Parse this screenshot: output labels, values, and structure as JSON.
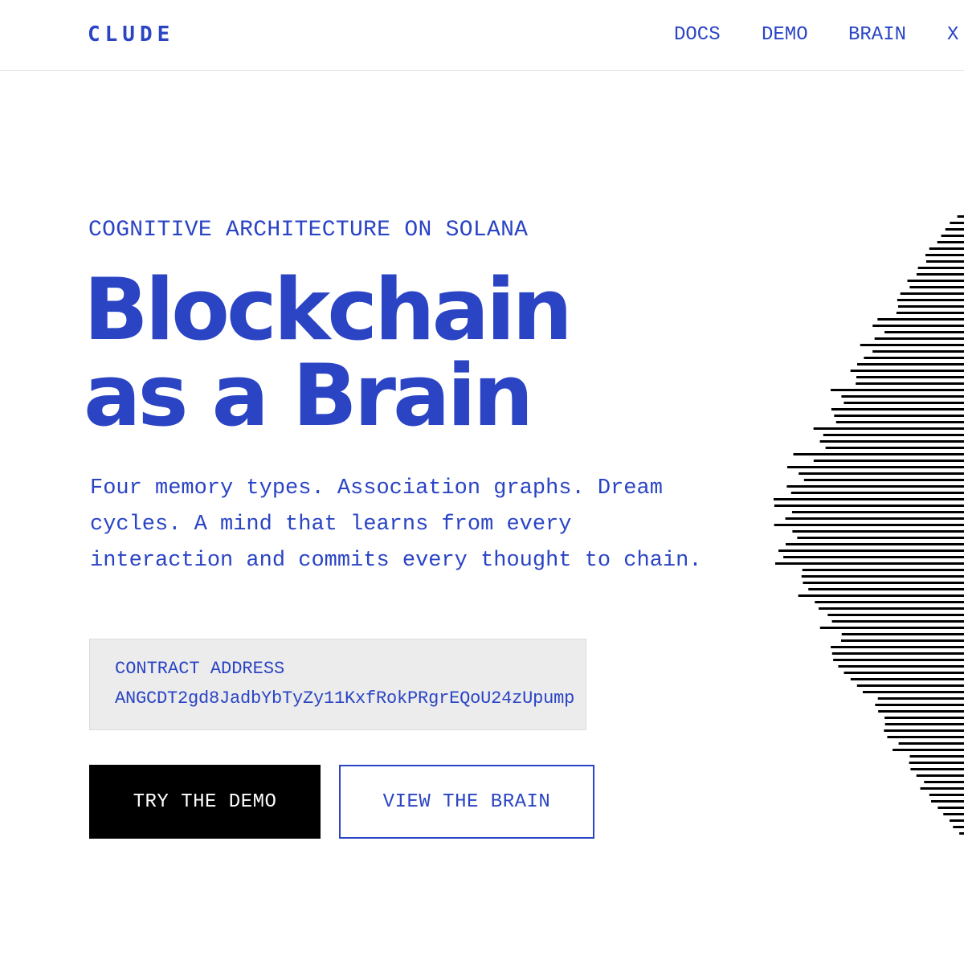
{
  "header": {
    "logo": "CLUDE",
    "nav": [
      "DOCS",
      "DEMO",
      "BRAIN",
      "X"
    ]
  },
  "hero": {
    "eyebrow": "COGNITIVE ARCHITECTURE ON SOLANA",
    "headline_line1": "Blockchain",
    "headline_line2": "as a Brain",
    "description": "Four memory types. Association graphs. Dream cycles. A mind that learns from every interaction and commits every thought to chain."
  },
  "contract": {
    "label": "CONTRACT ADDRESS",
    "address": "ANGCDT2gd8JadbYbTyZy11KxfRokPRgrEQoU24zUpump"
  },
  "buttons": {
    "primary": "TRY THE DEMO",
    "secondary": "VIEW THE BRAIN"
  },
  "colors": {
    "accent": "#2a44c4",
    "primary_button_bg": "#000000",
    "contract_bg": "#ececec",
    "wave_lines": "#000000"
  }
}
